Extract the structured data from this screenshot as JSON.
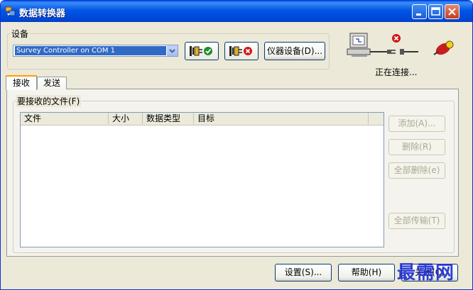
{
  "window": {
    "title": "数据转换器",
    "icon": "app-transfer-icon"
  },
  "title_buttons": {
    "minimize": "minimize-icon",
    "maximize": "maximize-icon",
    "close": "close-icon"
  },
  "device_group": {
    "label": "设备",
    "selected_device": "Survey Controller on COM 1",
    "connect_icon": "connect-icon",
    "disconnect_icon": "disconnect-icon",
    "instrument_button": "仪器设备(D)..."
  },
  "status": {
    "text": "正在连接..."
  },
  "tabs": [
    {
      "label": "接收"
    },
    {
      "label": "发送"
    }
  ],
  "receive": {
    "group_label": "要接收的文件(F)",
    "columns": [
      "文件",
      "大小",
      "数据类型",
      "目标"
    ],
    "rows": [],
    "buttons": {
      "add": "添加(A)...",
      "delete": "删除(R)",
      "delete_all": "全部删除(e)",
      "transfer_all": "全部传输(T)"
    }
  },
  "footer": {
    "settings": "设置(S)...",
    "help": "帮助(H)",
    "close": "关闭(C)"
  },
  "watermark": "最需网"
}
